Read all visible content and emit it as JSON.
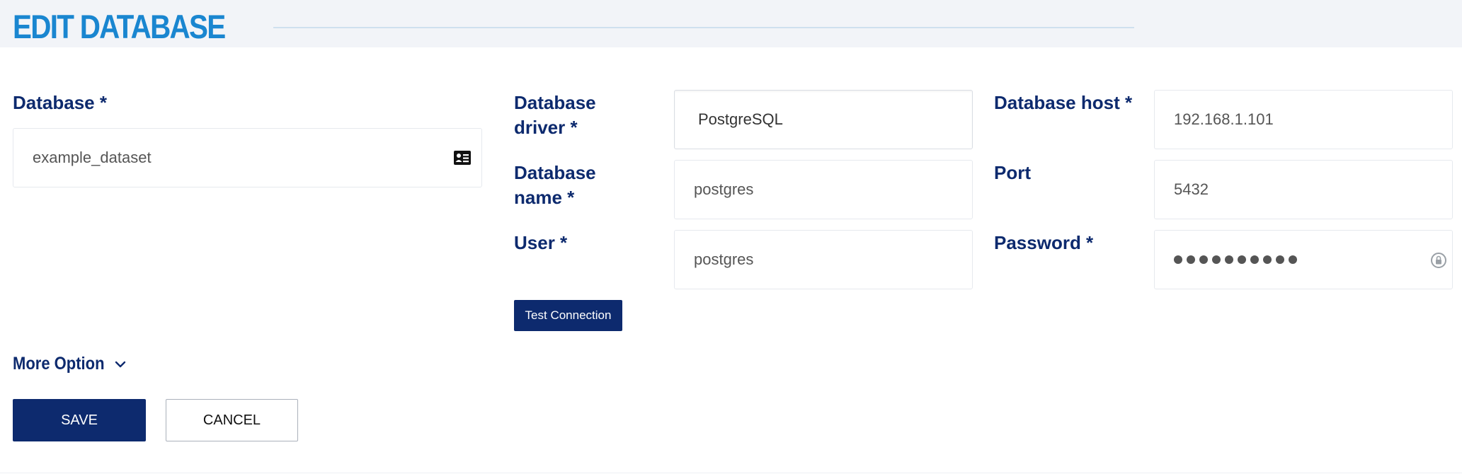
{
  "header": {
    "title": "EDIT DATABASE"
  },
  "form": {
    "database": {
      "label": "Database *",
      "value": "example_dataset",
      "icon": "id-card-icon"
    },
    "driver": {
      "label": "Database driver *",
      "value": "PostgreSQL"
    },
    "host": {
      "label": "Database host *",
      "value": "192.168.1.101"
    },
    "name": {
      "label": "Database name *",
      "value": "postgres"
    },
    "port": {
      "label": "Port",
      "value": "5432"
    },
    "user": {
      "label": "User *",
      "value": "postgres"
    },
    "password": {
      "label": "Password *",
      "masked_length": 10,
      "icon": "lock-icon"
    }
  },
  "actions": {
    "test_connection": "Test Connection",
    "more_option": "More Option",
    "save": "SAVE",
    "cancel": "CANCEL"
  },
  "colors": {
    "primary": "#0d2a6e",
    "title": "#1a86d0",
    "header_bg": "#f2f4f8"
  }
}
